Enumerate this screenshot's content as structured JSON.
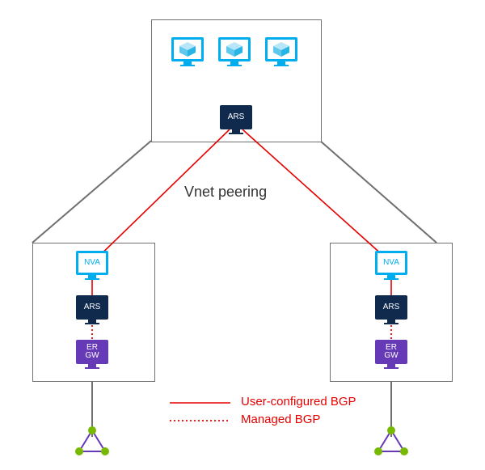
{
  "diagram": {
    "center_label": "Vnet peering",
    "hub": {
      "ars_label": "ARS",
      "vm_count": 3
    },
    "spoke_left": {
      "nva_label": "NVA",
      "ars_label": "ARS",
      "ergw_label_line1": "ER",
      "ergw_label_line2": "GW"
    },
    "spoke_right": {
      "nva_label": "NVA",
      "ars_label": "ARS",
      "ergw_label_line1": "ER",
      "ergw_label_line2": "GW"
    },
    "legend": {
      "user_bgp": "User-configured BGP",
      "managed_bgp": "Managed BGP"
    },
    "colors": {
      "user_bgp_line": "#e60000",
      "managed_bgp_line": "#e60000",
      "grey_line": "#6f6f6f",
      "ars_color": "#0F2A4D",
      "nva_color": "#00AEEF",
      "ergw_color": "#663AB7",
      "wan_node": "#76B900",
      "wan_edge": "#663AB7"
    }
  }
}
